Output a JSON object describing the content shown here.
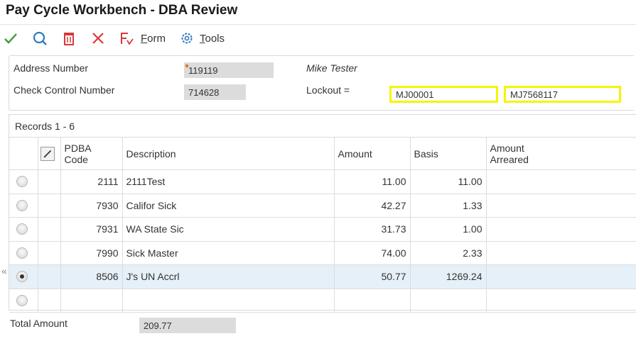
{
  "window": {
    "title": "Pay Cycle Workbench - DBA Review"
  },
  "toolbar": {
    "icons": [
      "ok-check-icon",
      "find-icon",
      "delete-icon",
      "cancel-icon"
    ],
    "form_label": "Form",
    "form_underline": "F",
    "form_rest": "orm",
    "tools_label": "Tools",
    "tools_underline": "T",
    "tools_rest": "ools"
  },
  "header": {
    "address_number_label": "Address Number",
    "address_number_value": "119119",
    "employee_name": "Mike Tester",
    "check_control_label": "Check Control Number",
    "check_control_value": "714628",
    "lockout_label": "Lockout =",
    "lockout_value_1": "MJ00001",
    "lockout_value_2": "MJ7568117"
  },
  "grid": {
    "records_label": "Records 1 - 6",
    "columns": {
      "pdba_code": "PDBA Code",
      "pdba_line1": "PDBA",
      "pdba_line2": "Code",
      "description": "Description",
      "amount": "Amount",
      "basis": "Basis",
      "amount_arreared": "Amount Arreared",
      "arreared_line1": "Amount",
      "arreared_line2": "Arreared"
    },
    "rows": [
      {
        "code": "2111",
        "description": "2111Test",
        "amount": "11.00",
        "basis": "11.00",
        "arreared": "",
        "selected": false
      },
      {
        "code": "7930",
        "description": "Califor Sick",
        "amount": "42.27",
        "basis": "1.33",
        "arreared": "",
        "selected": false
      },
      {
        "code": "7931",
        "description": "WA State Sic",
        "amount": "31.73",
        "basis": "1.00",
        "arreared": "",
        "selected": false
      },
      {
        "code": "7990",
        "description": "Sick Master",
        "amount": "74.00",
        "basis": "2.33",
        "arreared": "",
        "selected": false
      },
      {
        "code": "8506",
        "description": "J's UN Accrl",
        "amount": "50.77",
        "basis": "1269.24",
        "arreared": "",
        "selected": true
      },
      {
        "code": "",
        "description": "",
        "amount": "",
        "basis": "",
        "arreared": "",
        "selected": false
      }
    ]
  },
  "footer": {
    "total_amount_label": "Total Amount",
    "total_amount_value": "209.77"
  },
  "colors": {
    "highlight_border": "#f5f500",
    "selected_row": "#e6f0f8",
    "ok_green": "#3a9a3a",
    "accent_blue": "#2f7bbf",
    "delete_red": "#d9383a"
  }
}
